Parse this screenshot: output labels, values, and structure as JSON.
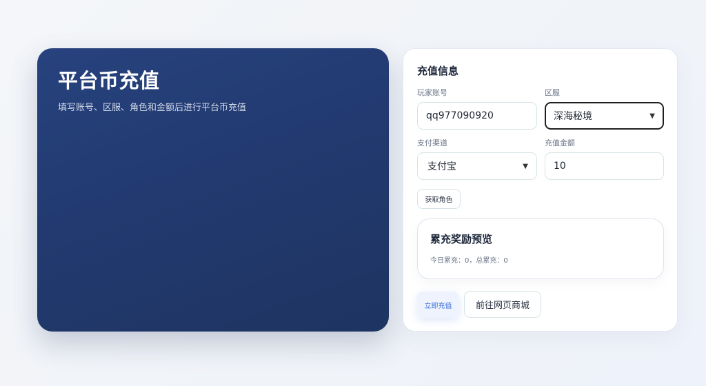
{
  "hero": {
    "title": "平台币充值",
    "subtitle": "填写账号、区服、角色和金额后进行平台币充值"
  },
  "form": {
    "title": "充值信息",
    "account": {
      "label": "玩家账号",
      "value": "qq977090920"
    },
    "server": {
      "label": "区服",
      "value": "深海秘境"
    },
    "payment": {
      "label": "支付渠道",
      "value": "支付宝"
    },
    "amount": {
      "label": "充值金额",
      "value": "10"
    },
    "get_role_label": "获取角色"
  },
  "reward": {
    "title": "累充奖励预览",
    "summary": "今日累充：0，总累充：0"
  },
  "actions": {
    "recharge_label": "立即充值",
    "shop_label": "前往网页商城"
  },
  "colors": {
    "hero_bg": "#223a70",
    "primary_text": "#3a6fd8",
    "primary_bg": "#eef3fd"
  }
}
